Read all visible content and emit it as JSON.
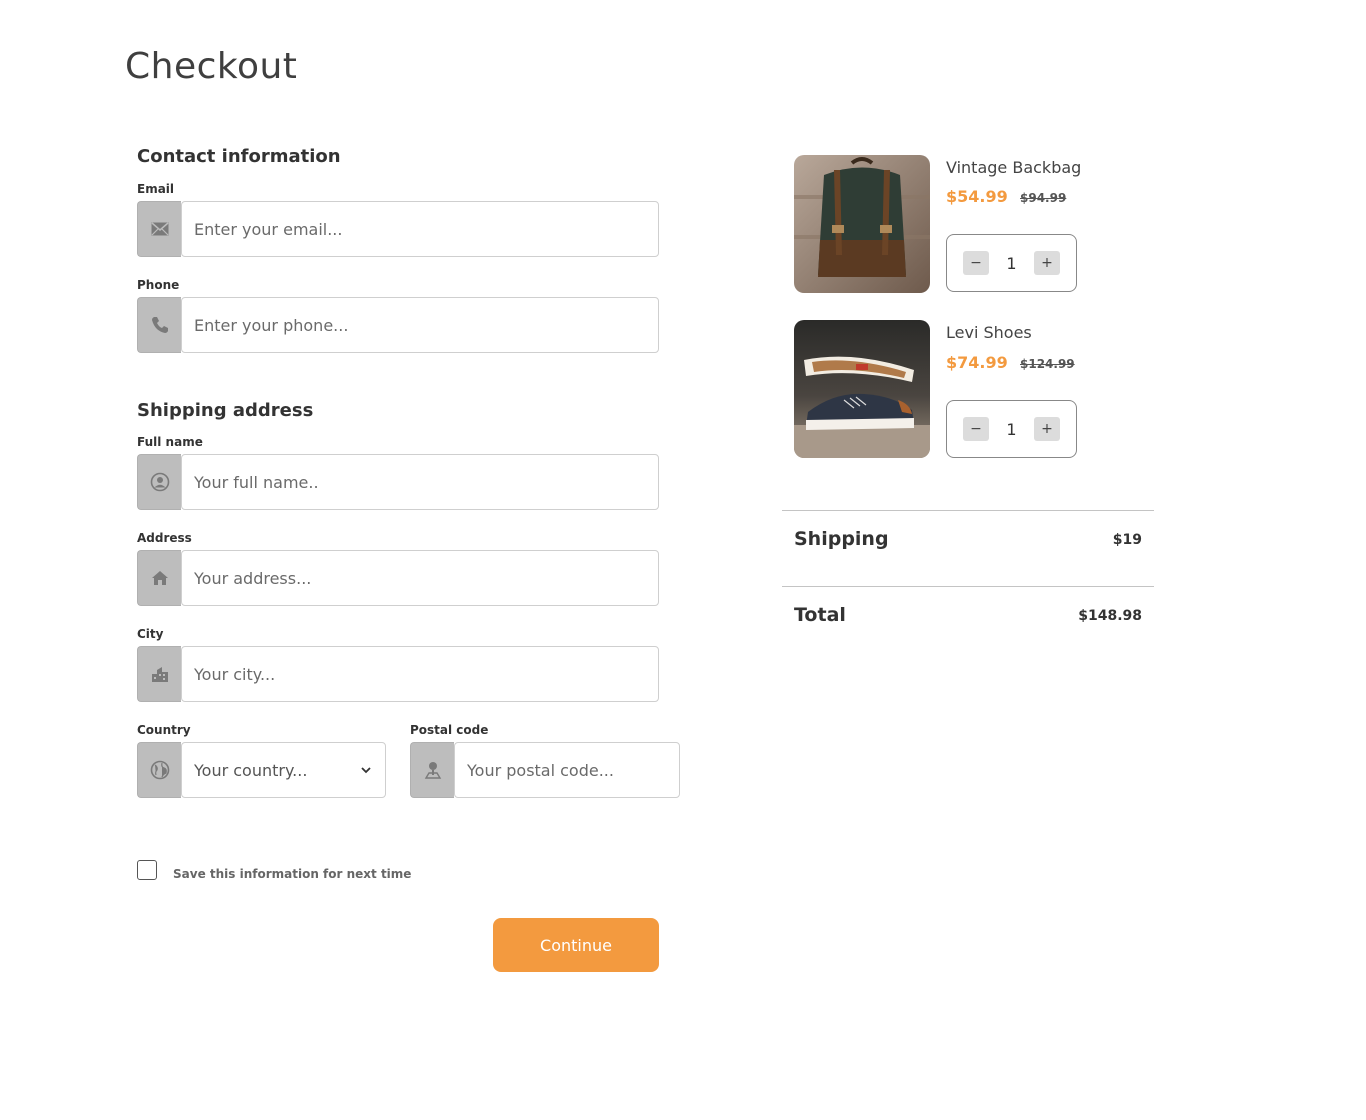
{
  "page": {
    "title": "Checkout"
  },
  "contact": {
    "heading": "Contact information",
    "email": {
      "label": "Email",
      "placeholder": "Enter your email...",
      "icon": "envelope-icon"
    },
    "phone": {
      "label": "Phone",
      "placeholder": "Enter your phone...",
      "icon": "phone-icon"
    }
  },
  "shipping": {
    "heading": "Shipping address",
    "full_name": {
      "label": "Full name",
      "placeholder": "Your full name..",
      "icon": "user-icon"
    },
    "address": {
      "label": "Address",
      "placeholder": "Your address...",
      "icon": "home-icon"
    },
    "city": {
      "label": "City",
      "placeholder": "Your city...",
      "icon": "building-icon"
    },
    "country": {
      "label": "Country",
      "value": "Your country...",
      "icon": "globe-icon"
    },
    "postal": {
      "label": "Postal code",
      "placeholder": "Your postal code...",
      "icon": "map-pin-icon"
    }
  },
  "save_info": {
    "label": "Save this information for next time",
    "checked": false
  },
  "continue_label": "Continue",
  "cart": {
    "items": [
      {
        "name": "Vintage Backbag",
        "price": "$54.99",
        "old_price": "$94.99",
        "quantity": "1"
      },
      {
        "name": "Levi Shoes",
        "price": "$74.99",
        "old_price": "$124.99",
        "quantity": "1"
      }
    ],
    "qty_minus": "−",
    "qty_plus": "+"
  },
  "summary": {
    "shipping_label": "Shipping",
    "shipping_value": "$19",
    "total_label": "Total",
    "total_value": "$148.98"
  },
  "colors": {
    "accent": "#f39a3f",
    "icon_bg": "#bdbdbd"
  }
}
